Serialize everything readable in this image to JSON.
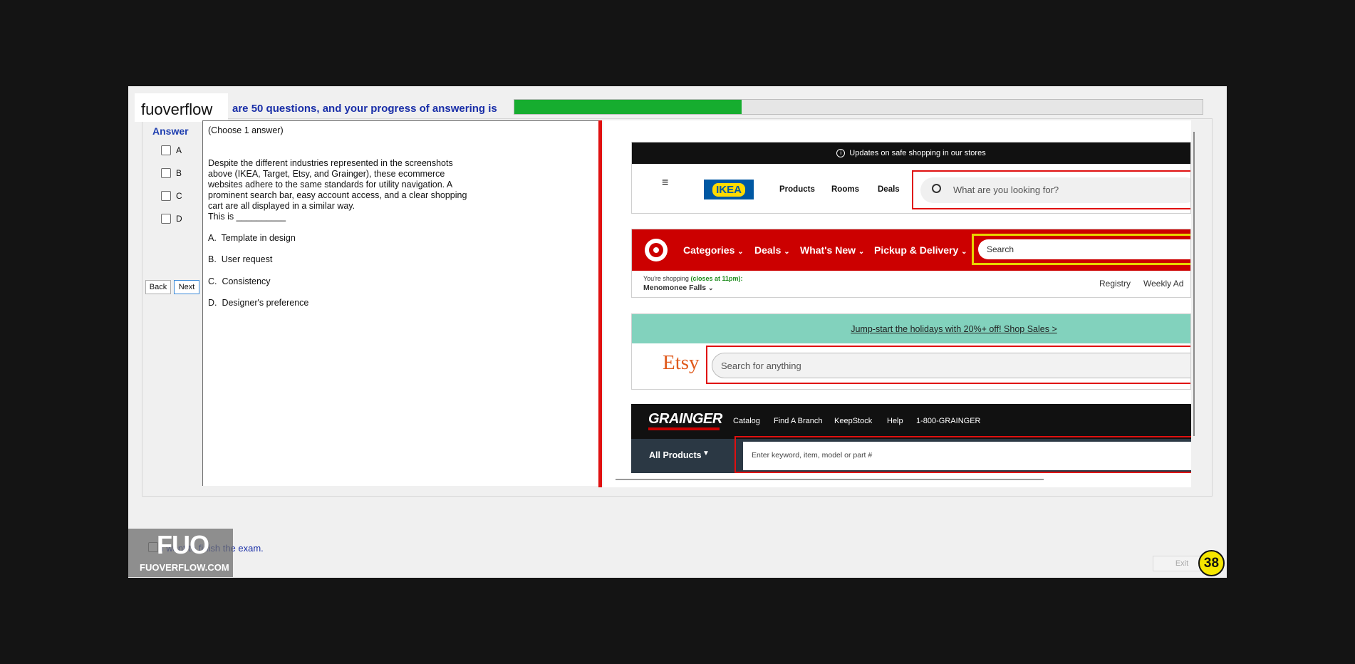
{
  "brand": "fuoverflow",
  "progress": {
    "text": "are 50 questions, and your progress of answering is",
    "fraction": 0.33,
    "fill_color": "#16ad2f"
  },
  "answer_panel": {
    "label": "Answer",
    "options": [
      "A",
      "B",
      "C",
      "D"
    ],
    "back_label": "Back",
    "next_label": "Next"
  },
  "question": {
    "instruction": "(Choose 1 answer)",
    "body_lines": [
      "Despite the different industries represented in the screenshots",
      "above (IKEA, Target, Etsy, and Grainger), these ecommerce",
      "websites adhere to the same standards for utility navigation. A",
      "prominent search bar, easy account access, and a clear shopping",
      "cart are all displayed in a similar way.",
      "This is __________"
    ],
    "choices": [
      {
        "letter": "A.",
        "text": "Template in design"
      },
      {
        "letter": "B.",
        "text": "User request"
      },
      {
        "letter": "C.",
        "text": "Consistency"
      },
      {
        "letter": "D.",
        "text": "Designer's preference"
      }
    ]
  },
  "screenshot": {
    "ikea": {
      "banner": "Updates on safe shopping in our stores",
      "logo": "IKEA",
      "nav": [
        "Products",
        "Rooms",
        "Deals"
      ],
      "search_placeholder": "What are you looking for?"
    },
    "target": {
      "nav": [
        "Categories",
        "Deals",
        "What's New",
        "Pickup & Delivery"
      ],
      "search_placeholder": "Search",
      "store_prefix": "You're shopping",
      "store_hours": "(closes at 11pm):",
      "store_name": "Menomonee Falls",
      "links": [
        "Registry",
        "Weekly Ad"
      ]
    },
    "etsy": {
      "banner": "Jump-start the holidays with 20%+ off! Shop Sales >",
      "logo": "Etsy",
      "search_placeholder": "Search for anything"
    },
    "grainger": {
      "logo": "GRAINGER",
      "nav": [
        "Catalog",
        "Find A Branch",
        "KeepStock",
        "Help",
        "1-800-GRAINGER"
      ],
      "all_products": "All Products",
      "search_placeholder": "Enter keyword, item, model or part #"
    }
  },
  "footer": {
    "finish_text": "I want to finish the exam.",
    "watermark_top": "FUO",
    "watermark_bottom": "FUOVERFLOW.COM",
    "exit_label": "Exit",
    "page_number": "38"
  }
}
